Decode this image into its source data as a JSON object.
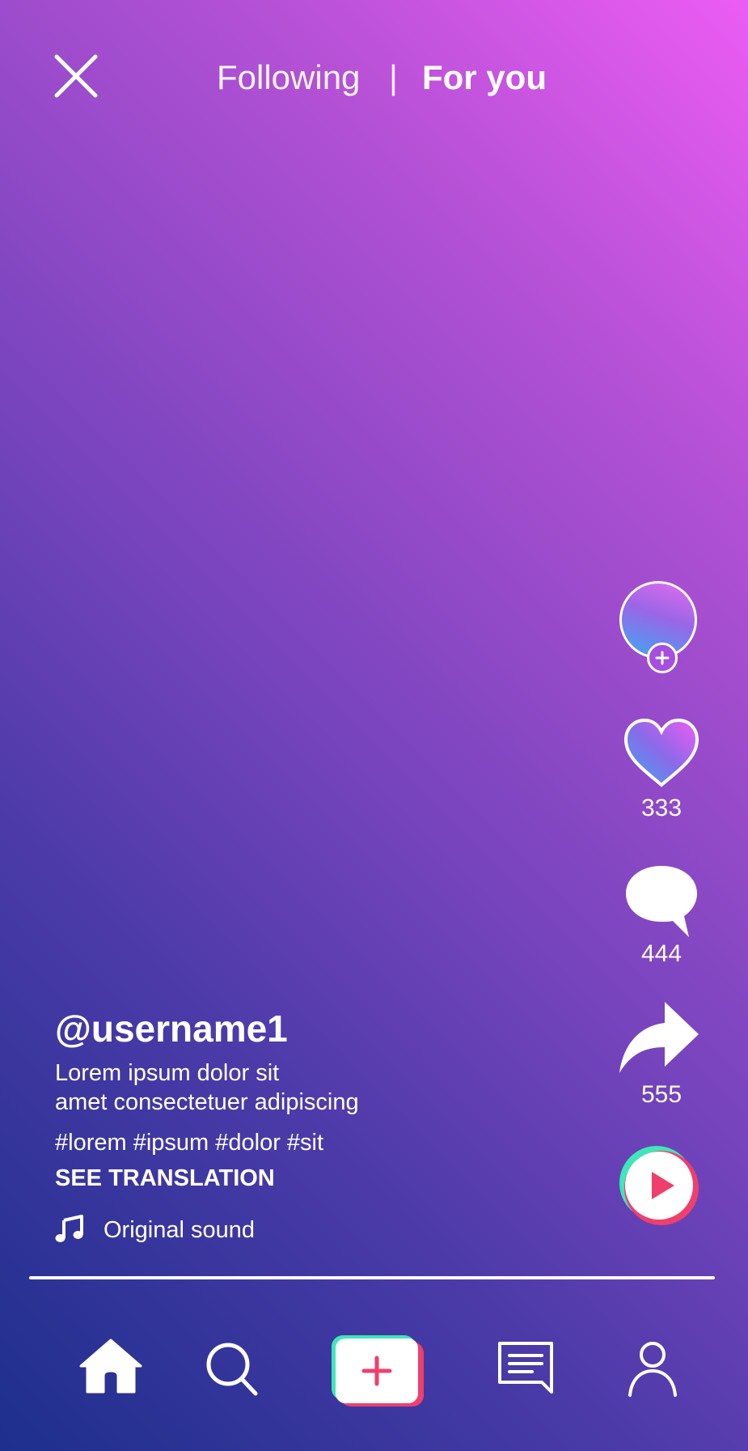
{
  "header": {
    "close_icon": "close-icon",
    "tab_following": "Following",
    "divider": "|",
    "tab_for_you": "For you"
  },
  "rail": {
    "avatar_icon": "avatar",
    "follow_icon": "plus-icon",
    "like_icon": "heart-icon",
    "like_count": "333",
    "comment_icon": "comment-icon",
    "comment_count": "444",
    "share_icon": "share-icon",
    "share_count": "555",
    "sound_icon": "play-icon"
  },
  "caption": {
    "username": "@username1",
    "description_line1": "Lorem ipsum dolor sit",
    "description_line2": "amet consectetuer adipiscing",
    "hashtags": "#lorem #ipsum #dolor #sit",
    "see_translation": "SEE TRANSLATION",
    "music_icon": "music-note-icon",
    "sound": "Original sound"
  },
  "nav": {
    "items": [
      "home-icon",
      "search-icon",
      "create-icon",
      "inbox-icon",
      "profile-icon"
    ]
  },
  "colors": {
    "gradient_top_right": "#ec5cf4",
    "gradient_bottom_left": "#1d2f8c",
    "accent_red": "#ef3f6c",
    "accent_teal": "#3fe6b8",
    "accent_blue": "#3fa7f5"
  }
}
